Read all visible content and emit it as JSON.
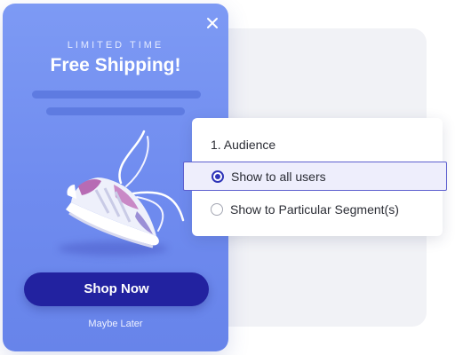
{
  "popup": {
    "eyebrow": "LIMITED TIME",
    "headline": "Free Shipping!",
    "cta_label": "Shop Now",
    "dismiss_label": "Maybe Later",
    "close_icon": "close-icon",
    "product_image": "sneaker-image"
  },
  "audience_card": {
    "title": "1. Audience",
    "options": [
      {
        "label": "Show to all users",
        "selected": true
      },
      {
        "label": "Show to Particular Segment(s)",
        "selected": false
      }
    ]
  },
  "colors": {
    "popup_background": "#7491f1",
    "cta_background": "#2222a0",
    "selected_option_border": "#5d5fcf",
    "selected_option_background": "#eeeefc"
  }
}
